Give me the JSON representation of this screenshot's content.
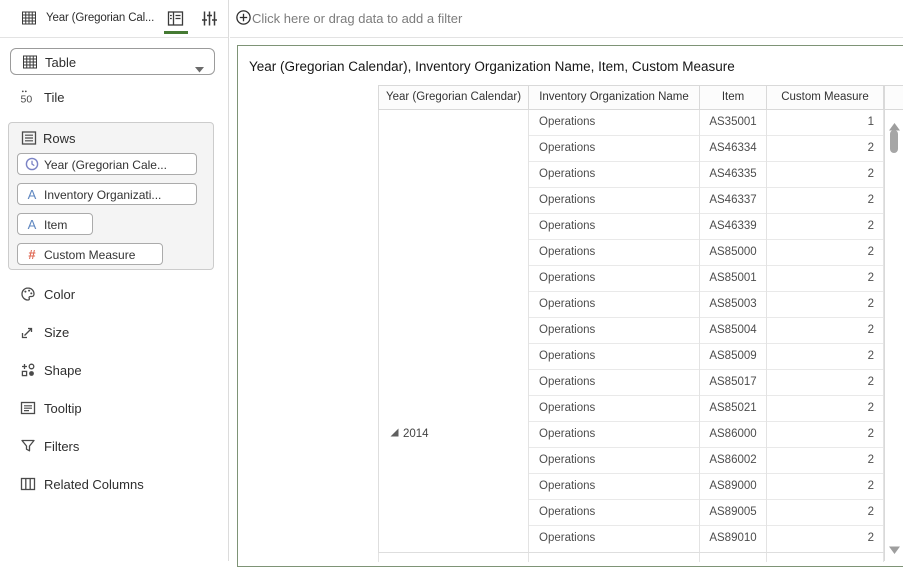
{
  "sidebar": {
    "viz_tab": {
      "title": "Year (Gregorian Cal..."
    },
    "viz_type_select": {
      "value": "Table"
    },
    "tile": {
      "badge": "50",
      "label": "Tile"
    },
    "rows_section": {
      "label": "Rows",
      "pills": [
        {
          "icon": "clock",
          "label": "Year (Gregorian Cale..."
        },
        {
          "icon": "letter-a",
          "label": "Inventory Organizati..."
        },
        {
          "icon": "letter-a",
          "label": "Item"
        },
        {
          "icon": "hash",
          "label": "Custom Measure"
        }
      ]
    },
    "items": [
      {
        "icon": "color",
        "label": "Color"
      },
      {
        "icon": "size",
        "label": "Size"
      },
      {
        "icon": "shape",
        "label": "Shape"
      },
      {
        "icon": "tooltip",
        "label": "Tooltip"
      },
      {
        "icon": "filters",
        "label": "Filters"
      },
      {
        "icon": "related-columns",
        "label": "Related Columns"
      }
    ]
  },
  "filter_bar": {
    "prompt": "Click here or drag data to add a filter"
  },
  "canvas": {
    "title": "Year (Gregorian Calendar), Inventory Organization Name, Item, Custom Measure",
    "table": {
      "columns": [
        "Year (Gregorian Calendar)",
        "Inventory Organization Name",
        "Item",
        "Custom Measure"
      ],
      "group": {
        "year": "2014"
      },
      "rows": [
        {
          "org": "Operations",
          "item": "AS35001",
          "measure": "1"
        },
        {
          "org": "Operations",
          "item": "AS46334",
          "measure": "2"
        },
        {
          "org": "Operations",
          "item": "AS46335",
          "measure": "2"
        },
        {
          "org": "Operations",
          "item": "AS46337",
          "measure": "2"
        },
        {
          "org": "Operations",
          "item": "AS46339",
          "measure": "2"
        },
        {
          "org": "Operations",
          "item": "AS85000",
          "measure": "2"
        },
        {
          "org": "Operations",
          "item": "AS85001",
          "measure": "2"
        },
        {
          "org": "Operations",
          "item": "AS85003",
          "measure": "2"
        },
        {
          "org": "Operations",
          "item": "AS85004",
          "measure": "2"
        },
        {
          "org": "Operations",
          "item": "AS85009",
          "measure": "2"
        },
        {
          "org": "Operations",
          "item": "AS85017",
          "measure": "2"
        },
        {
          "org": "Operations",
          "item": "AS85021",
          "measure": "2"
        },
        {
          "org": "Operations",
          "item": "AS86000",
          "measure": "2"
        },
        {
          "org": "Operations",
          "item": "AS86002",
          "measure": "2"
        },
        {
          "org": "Operations",
          "item": "AS89000",
          "measure": "2"
        },
        {
          "org": "Operations",
          "item": "AS89005",
          "measure": "2"
        },
        {
          "org": "Operations",
          "item": "AS89010",
          "measure": "2"
        }
      ]
    }
  },
  "colors": {
    "accent_green": "#457a33",
    "viz_border": "#7e9376",
    "clock_icon": "#7b83c5",
    "attribute_icon": "#5f87c0",
    "measure_icon": "#df6753"
  }
}
